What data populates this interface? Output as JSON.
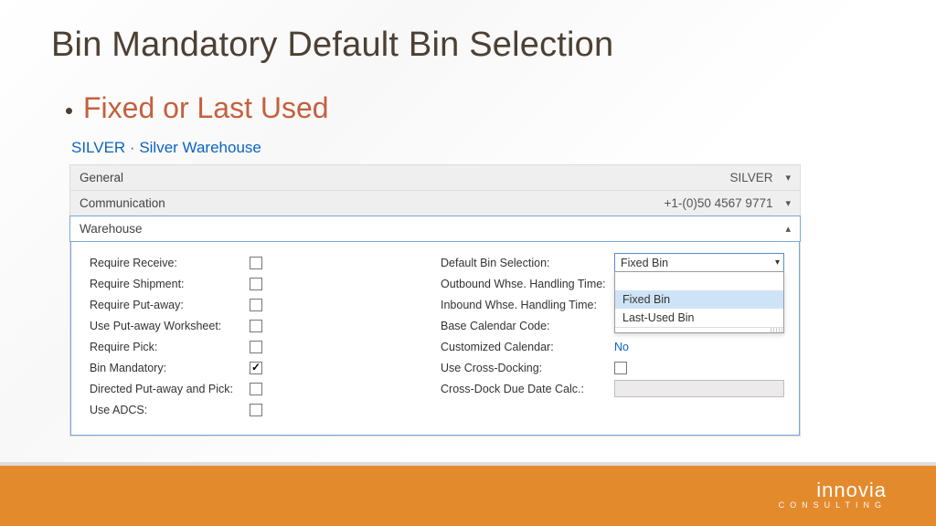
{
  "title": "Bin Mandatory Default Bin Selection",
  "subtitle": "Fixed or Last Used",
  "card_header": "SILVER · Silver Warehouse",
  "sections": {
    "general": {
      "label": "General",
      "summary": "SILVER"
    },
    "communication": {
      "label": "Communication",
      "summary": "+1-(0)50 4567 9771"
    },
    "warehouse": {
      "label": "Warehouse"
    }
  },
  "warehouse": {
    "left": [
      {
        "label": "Require Receive:",
        "checked": false
      },
      {
        "label": "Require Shipment:",
        "checked": false
      },
      {
        "label": "Require Put-away:",
        "checked": false
      },
      {
        "label": "Use Put-away Worksheet:",
        "checked": false
      },
      {
        "label": "Require Pick:",
        "checked": false
      },
      {
        "label": "Bin Mandatory:",
        "checked": true
      },
      {
        "label": "Directed Put-away and Pick:",
        "checked": false
      },
      {
        "label": "Use ADCS:",
        "checked": false
      }
    ],
    "right": {
      "default_bin_label": "Default Bin Selection:",
      "default_bin_value": "Fixed Bin",
      "default_bin_options": [
        "Fixed Bin",
        "Last-Used Bin"
      ],
      "outbound_label": "Outbound Whse. Handling Time:",
      "inbound_label": "Inbound Whse. Handling Time:",
      "base_cal_label": "Base Calendar Code:",
      "cust_cal_label": "Customized Calendar:",
      "cust_cal_value": "No",
      "cross_dock_label": "Use Cross-Docking:",
      "cross_dock_checked": false,
      "cross_calc_label": "Cross-Dock Due Date Calc.:"
    }
  },
  "brand": {
    "name": "innovia",
    "tag": "CONSULTING"
  },
  "colors": {
    "accent_orange": "#e38a2d",
    "title_brown": "#4c4034",
    "subtitle_orange": "#c4603e",
    "link_blue": "#0b64c0"
  }
}
